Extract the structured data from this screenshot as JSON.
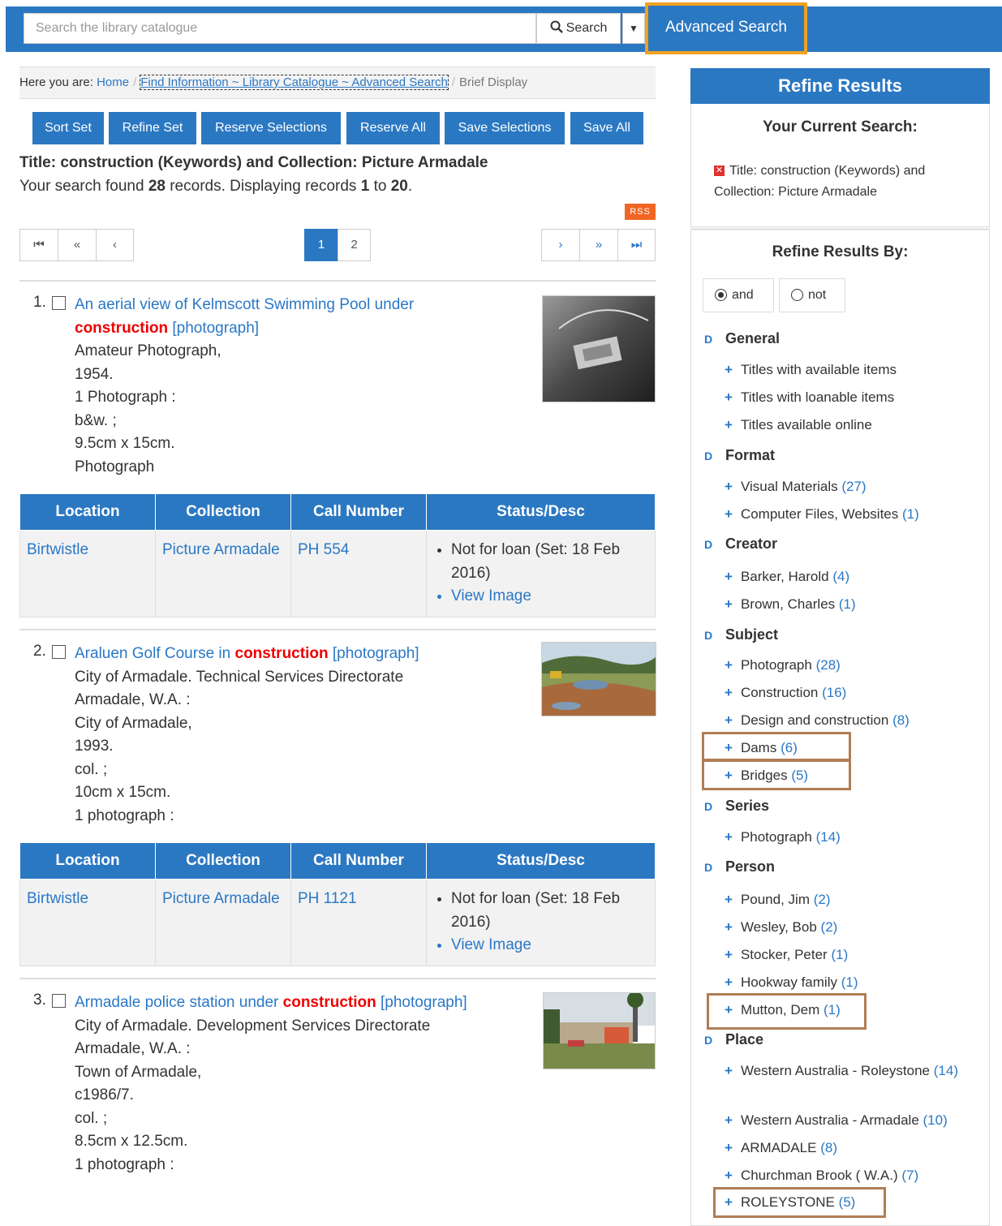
{
  "search": {
    "placeholder": "Search the library catalogue",
    "search_label": "Search",
    "advanced_label": "Advanced Search"
  },
  "breadcrumb": {
    "prefix": "Here you are:",
    "home": "Home",
    "find": "Find Information ~ Library Catalogue ~ Advanced Search",
    "current": "Brief Display"
  },
  "actions": [
    "Sort Set",
    "Refine Set",
    "Reserve Selections",
    "Reserve All",
    "Save Selections",
    "Save All"
  ],
  "results": {
    "title": "Title: construction (Keywords) and Collection: Picture Armadale",
    "found_pre": "Your search found",
    "total": "28",
    "found_mid": "records. Displaying records",
    "from": "1",
    "to_word": "to",
    "to": "20",
    "rss": "RSS"
  },
  "pagination": {
    "pages": [
      "1",
      "2"
    ],
    "current": "1"
  },
  "records": [
    {
      "num": "1.",
      "title_pre": "An aerial view of Kelmscott Swimming Pool under",
      "highlight": "construction",
      "title_post": "[photograph]",
      "lines": [
        "Amateur Photograph,",
        "1954.",
        "1 Photograph :",
        "b&w. ;",
        "9.5cm x 15cm.",
        "Photograph"
      ],
      "holdings": {
        "location": "Birtwistle",
        "collection": "Picture Armadale",
        "call": "PH 554",
        "status": "Not for loan (Set: 18 Feb 2016)",
        "view": "View Image"
      }
    },
    {
      "num": "2.",
      "title_pre": "Araluen Golf Course in",
      "highlight": "construction",
      "title_post": "[photograph]",
      "lines": [
        "City of Armadale. Technical Services Directorate",
        "Armadale, W.A. :",
        "City of Armadale,",
        "1993.",
        "col. ;",
        "10cm x 15cm.",
        "1 photograph :"
      ],
      "holdings": {
        "location": "Birtwistle",
        "collection": "Picture Armadale",
        "call": "PH 1121",
        "status": "Not for loan (Set: 18 Feb 2016)",
        "view": "View Image"
      }
    },
    {
      "num": "3.",
      "title_pre": "Armadale police station under",
      "highlight": "construction",
      "title_post": "[photograph]",
      "lines": [
        "City of Armadale. Development Services Directorate",
        "Armadale, W.A. :",
        "Town of Armadale,",
        "c1986/7.",
        "col. ;",
        "8.5cm x 12.5cm.",
        "1 photograph :"
      ]
    }
  ],
  "table_headers": [
    "Location",
    "Collection",
    "Call Number",
    "Status/Desc"
  ],
  "sidebar": {
    "header": "Refine Results",
    "current_title": "Your Current Search:",
    "current_text": "Title: construction (Keywords) and Collection: Picture Armadale",
    "refine_by": "Refine Results By:",
    "and_label": "and",
    "not_label": "not",
    "facets": [
      {
        "name": "General",
        "items": [
          {
            "label": "Titles with available items",
            "count": ""
          },
          {
            "label": "Titles with loanable items",
            "count": ""
          },
          {
            "label": "Titles available online",
            "count": ""
          }
        ]
      },
      {
        "name": "Format",
        "items": [
          {
            "label": "Visual Materials",
            "count": "(27)"
          },
          {
            "label": "Computer Files, Websites",
            "count": "(1)"
          }
        ]
      },
      {
        "name": "Creator",
        "items": [
          {
            "label": "Barker, Harold",
            "count": "(4)"
          },
          {
            "label": "Brown, Charles",
            "count": "(1)"
          }
        ]
      },
      {
        "name": "Subject",
        "items": [
          {
            "label": "Photograph",
            "count": "(28)"
          },
          {
            "label": "Construction",
            "count": "(16)"
          },
          {
            "label": "Design and construction",
            "count": "(8)"
          },
          {
            "label": "Dams",
            "count": "(6)"
          },
          {
            "label": "Bridges",
            "count": "(5)"
          }
        ]
      },
      {
        "name": "Series",
        "items": [
          {
            "label": "Photograph",
            "count": "(14)"
          }
        ]
      },
      {
        "name": "Person",
        "items": [
          {
            "label": "Pound, Jim",
            "count": "(2)"
          },
          {
            "label": "Wesley, Bob",
            "count": "(2)"
          },
          {
            "label": "Stocker, Peter",
            "count": "(1)"
          },
          {
            "label": "Hookway family",
            "count": "(1)"
          },
          {
            "label": "Mutton, Dem",
            "count": "(1)"
          }
        ]
      },
      {
        "name": "Place",
        "items": [
          {
            "label": "Western Australia - Roleystone",
            "count": "(14)"
          },
          {
            "label": "Western Australia - Armadale",
            "count": "(10)"
          },
          {
            "label": "ARMADALE",
            "count": "(8)"
          },
          {
            "label": "Churchman Brook ( W.A.)",
            "count": "(7)"
          },
          {
            "label": "ROLEYSTONE",
            "count": "(5)"
          }
        ]
      }
    ]
  },
  "colors": {
    "primary": "#2b78c2",
    "highlight": "#f0a020",
    "annotation": "#b07d55",
    "keyword": "#e00000",
    "rss": "#f26522"
  }
}
